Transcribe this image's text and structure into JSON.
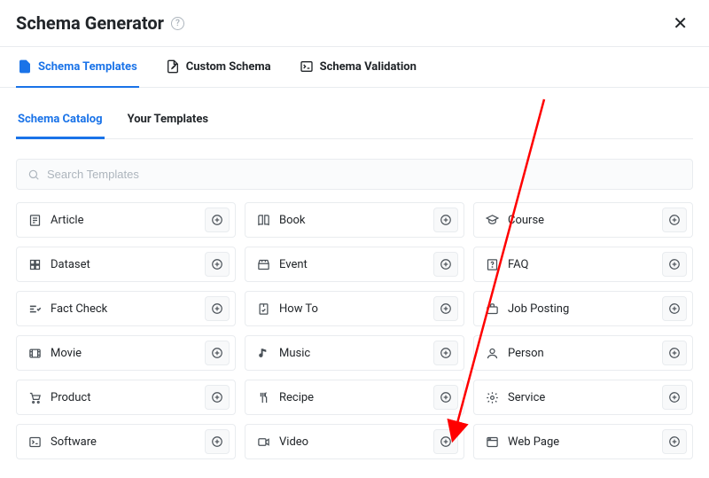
{
  "header": {
    "title": "Schema Generator"
  },
  "primary_tabs": {
    "templates": "Schema Templates",
    "custom": "Custom Schema",
    "validation": "Schema Validation"
  },
  "secondary_tabs": {
    "catalog": "Schema Catalog",
    "your": "Your Templates"
  },
  "search": {
    "placeholder": "Search Templates"
  },
  "cards": {
    "article": "Article",
    "book": "Book",
    "course": "Course",
    "dataset": "Dataset",
    "event": "Event",
    "faq": "FAQ",
    "factcheck": "Fact Check",
    "howto": "How To",
    "jobposting": "Job Posting",
    "movie": "Movie",
    "music": "Music",
    "person": "Person",
    "product": "Product",
    "recipe": "Recipe",
    "service": "Service",
    "software": "Software",
    "video": "Video",
    "webpage": "Web Page"
  }
}
